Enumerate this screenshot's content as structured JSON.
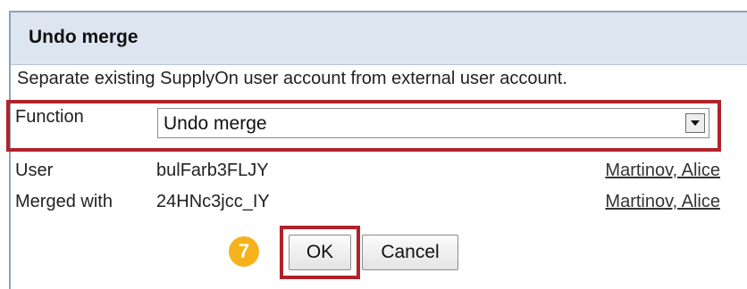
{
  "dialog": {
    "title": "Undo merge",
    "description": "Separate existing SupplyOn user account from external user account."
  },
  "function_field": {
    "label": "Function",
    "selected": "Undo merge"
  },
  "user_row": {
    "label": "User",
    "value": "bulFarb3FLJY",
    "link": "Martinov, Alice"
  },
  "merged_row": {
    "label": "Merged with",
    "value": "24HNc3jcc_IY",
    "link": "Martinov, Alice"
  },
  "step_badge": "7",
  "buttons": {
    "ok": "OK",
    "cancel": "Cancel"
  },
  "colors": {
    "highlight": "#b0232a",
    "titlebar": "#dde5f0",
    "badge": "#f6b21b"
  }
}
